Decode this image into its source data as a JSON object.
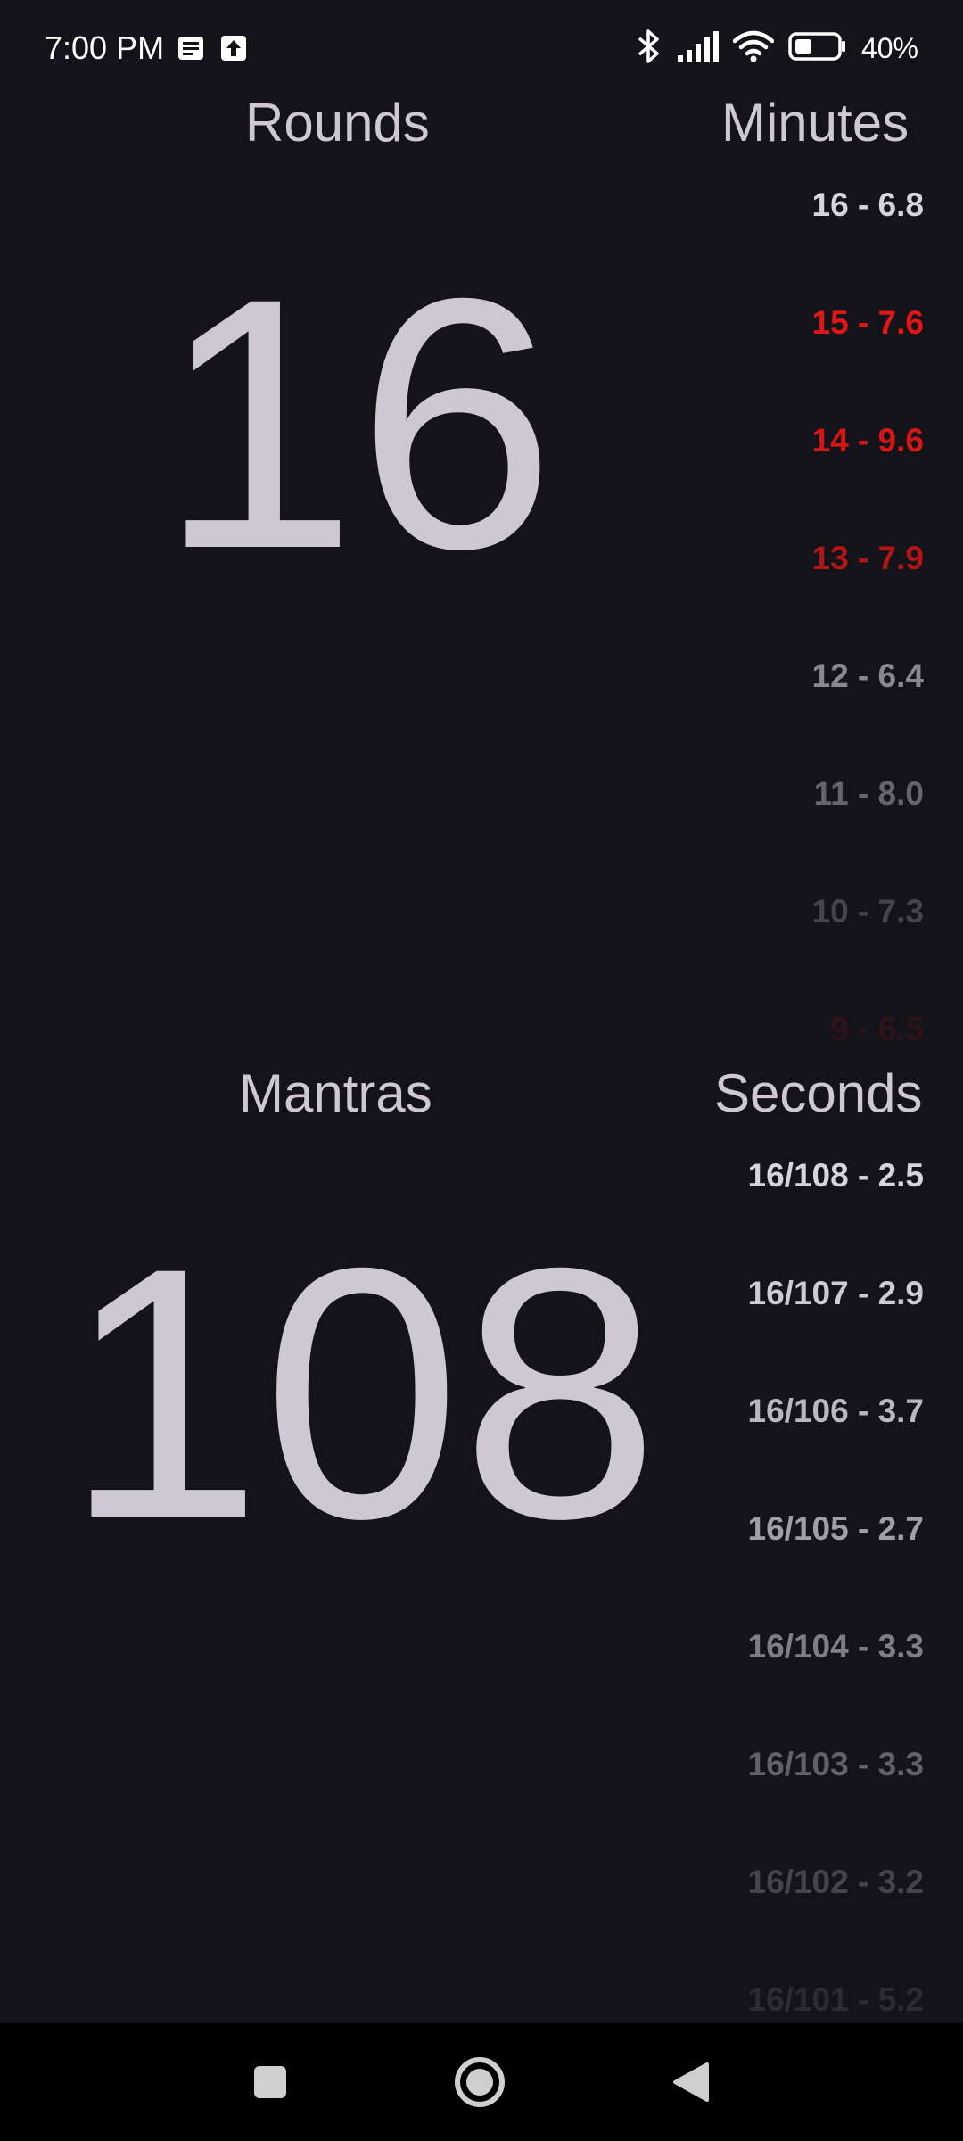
{
  "status_bar": {
    "time": "7:00 PM",
    "battery": "40%",
    "icons": [
      "notification-message-icon",
      "upload-icon",
      "bluetooth-icon",
      "signal-icon",
      "wifi-icon",
      "battery-icon"
    ]
  },
  "rounds": {
    "header": "Rounds",
    "value": "16"
  },
  "minutes": {
    "header": "Minutes",
    "items": [
      {
        "text": "16 - 6.8",
        "color": "#d8d4dc",
        "opacity": 1.0
      },
      {
        "text": "15 - 7.6",
        "color": "#e01717",
        "opacity": 1.0
      },
      {
        "text": "14 - 9.6",
        "color": "#e01717",
        "opacity": 0.95
      },
      {
        "text": "13 - 7.9",
        "color": "#e01717",
        "opacity": 0.78
      },
      {
        "text": "12 - 6.4",
        "color": "#d8d4dc",
        "opacity": 0.6
      },
      {
        "text": "11 - 8.0",
        "color": "#d8d4dc",
        "opacity": 0.42
      },
      {
        "text": "10 - 7.3",
        "color": "#d8d4dc",
        "opacity": 0.25
      },
      {
        "text": "9 - 6.5",
        "color": "#e01717",
        "opacity": 0.12
      }
    ]
  },
  "mantras": {
    "header": "Mantras",
    "value": "108"
  },
  "seconds": {
    "header": "Seconds",
    "items": [
      {
        "text": "16/108 - 2.5",
        "color": "#d8d4dc",
        "opacity": 1.0
      },
      {
        "text": "16/107 - 2.9",
        "color": "#d8d4dc",
        "opacity": 0.95
      },
      {
        "text": "16/106 - 3.7",
        "color": "#d8d4dc",
        "opacity": 0.85
      },
      {
        "text": "16/105 - 2.7",
        "color": "#d8d4dc",
        "opacity": 0.72
      },
      {
        "text": "16/104 - 3.3",
        "color": "#d8d4dc",
        "opacity": 0.55
      },
      {
        "text": "16/103 - 3.3",
        "color": "#d8d4dc",
        "opacity": 0.4
      },
      {
        "text": "16/102 - 3.2",
        "color": "#d8d4dc",
        "opacity": 0.25
      },
      {
        "text": "16/101 - 5.2",
        "color": "#d8d4dc",
        "opacity": 0.12
      }
    ]
  },
  "nav_bar": {
    "buttons": [
      "recents-button",
      "home-button",
      "back-button"
    ]
  },
  "colors": {
    "background": "#15131a",
    "text": "#cdc8d3",
    "accent_red": "#e01717"
  }
}
